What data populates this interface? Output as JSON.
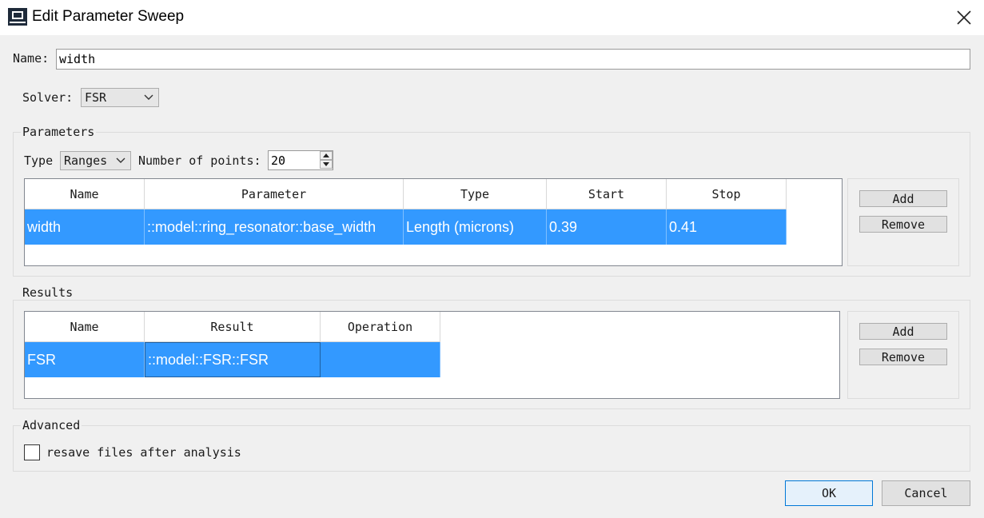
{
  "window": {
    "title": "Edit Parameter Sweep"
  },
  "name_field": {
    "label": "Name:",
    "value": "width"
  },
  "solver": {
    "label": "Solver:",
    "selected": "FSR"
  },
  "parameters": {
    "title": "Parameters",
    "type_label": "Type",
    "type_selected": "Ranges",
    "points_label": "Number of points:",
    "points_value": "20",
    "columns": [
      "Name",
      "Parameter",
      "Type",
      "Start",
      "Stop"
    ],
    "rows": [
      {
        "name": "width",
        "parameter": "::model::ring_resonator::base_width",
        "type": "Length (microns)",
        "start": "0.39",
        "stop": "0.41"
      }
    ],
    "add_label": "Add",
    "remove_label": "Remove"
  },
  "results": {
    "title": "Results",
    "columns": [
      "Name",
      "Result",
      "Operation"
    ],
    "rows": [
      {
        "name": "FSR",
        "result": "::model::FSR::FSR",
        "operation": ""
      }
    ],
    "add_label": "Add",
    "remove_label": "Remove"
  },
  "advanced": {
    "title": "Advanced",
    "checkbox_label": "resave files after analysis",
    "checked": false
  },
  "footer": {
    "ok_label": "OK",
    "cancel_label": "Cancel"
  },
  "colors": {
    "selection": "#3399ff",
    "ok_border": "#0078d7"
  },
  "icons": {
    "app": "app-window-icon",
    "close": "close-icon",
    "combo": "chevron-down-icon",
    "spin_up": "spin-up-icon",
    "spin_down": "spin-down-icon"
  }
}
